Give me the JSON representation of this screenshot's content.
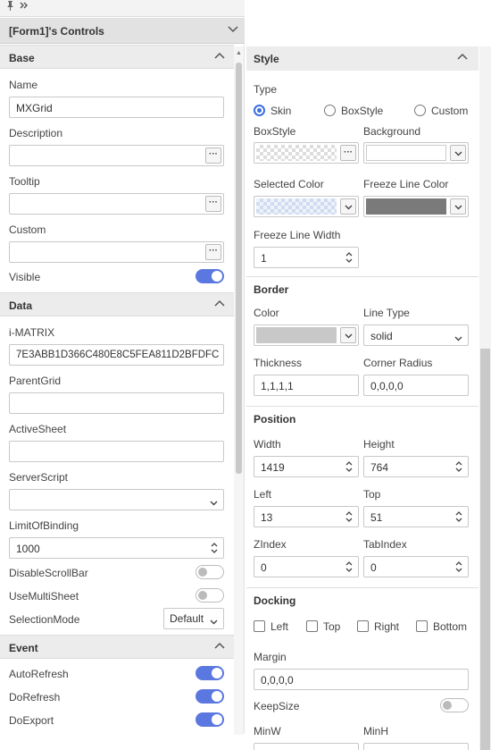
{
  "topbar": {
    "pin_icon": "pin-icon",
    "expand_icon": "double-chevron-right-icon"
  },
  "form_header": {
    "title": "[Form1]'s Controls"
  },
  "left": {
    "base": {
      "title": "Base",
      "name_label": "Name",
      "name_value": "MXGrid",
      "description_label": "Description",
      "description_value": "",
      "tooltip_label": "Tooltip",
      "tooltip_value": "",
      "custom_label": "Custom",
      "custom_value": "",
      "visible_label": "Visible",
      "visible": true,
      "ellipsis": "···"
    },
    "data": {
      "title": "Data",
      "imatrix_label": "i-MATRIX",
      "imatrix_value": "7E3ABB1D366C480E8C5FEA811D2BFDFC",
      "parentgrid_label": "ParentGrid",
      "parentgrid_value": "",
      "activesheet_label": "ActiveSheet",
      "activesheet_value": "",
      "serverscript_label": "ServerScript",
      "serverscript_value": "",
      "limit_label": "LimitOfBinding",
      "limit_value": "1000",
      "disablescroll_label": "DisableScrollBar",
      "disablescroll": false,
      "usemulti_label": "UseMultiSheet",
      "usemulti": false,
      "selmode_label": "SelectionMode",
      "selmode_value": "Default"
    },
    "event": {
      "title": "Event",
      "autorefresh_label": "AutoRefresh",
      "autorefresh": true,
      "dorefresh_label": "DoRefresh",
      "dorefresh": true,
      "doexport_label": "DoExport",
      "doexport": true
    }
  },
  "right": {
    "style": {
      "title": "Style",
      "type_label": "Type",
      "type_options": [
        "Skin",
        "BoxStyle",
        "Custom"
      ],
      "type_selected": "Skin",
      "boxstyle_label": "BoxStyle",
      "background_label": "Background",
      "selected_color_label": "Selected Color",
      "freeze_color_label": "Freeze Line Color",
      "freeze_width_label": "Freeze Line Width",
      "freeze_width_value": "1"
    },
    "border": {
      "title": "Border",
      "color_label": "Color",
      "linetype_label": "Line Type",
      "linetype_value": "solid",
      "thickness_label": "Thickness",
      "thickness_value": "1,1,1,1",
      "radius_label": "Corner Radius",
      "radius_value": "0,0,0,0"
    },
    "position": {
      "title": "Position",
      "width_label": "Width",
      "width_value": "1419",
      "height_label": "Height",
      "height_value": "764",
      "left_label": "Left",
      "left_value": "13",
      "top_label": "Top",
      "top_value": "51",
      "zindex_label": "ZIndex",
      "zindex_value": "0",
      "tabindex_label": "TabIndex",
      "tabindex_value": "0"
    },
    "docking": {
      "title": "Docking",
      "options": [
        "Left",
        "Top",
        "Right",
        "Bottom"
      ],
      "margin_label": "Margin",
      "margin_value": "0,0,0,0",
      "keepsize_label": "KeepSize",
      "keepsize": false,
      "minw_label": "MinW",
      "minh_label": "MinH"
    }
  },
  "colors": {
    "accent": "#5a78e0",
    "radio_selected": "#3b6fe0",
    "border_color_swatch": "#c8c8c8",
    "freeze_line_color": "#7a7a7a",
    "section_bg": "#ececec"
  }
}
